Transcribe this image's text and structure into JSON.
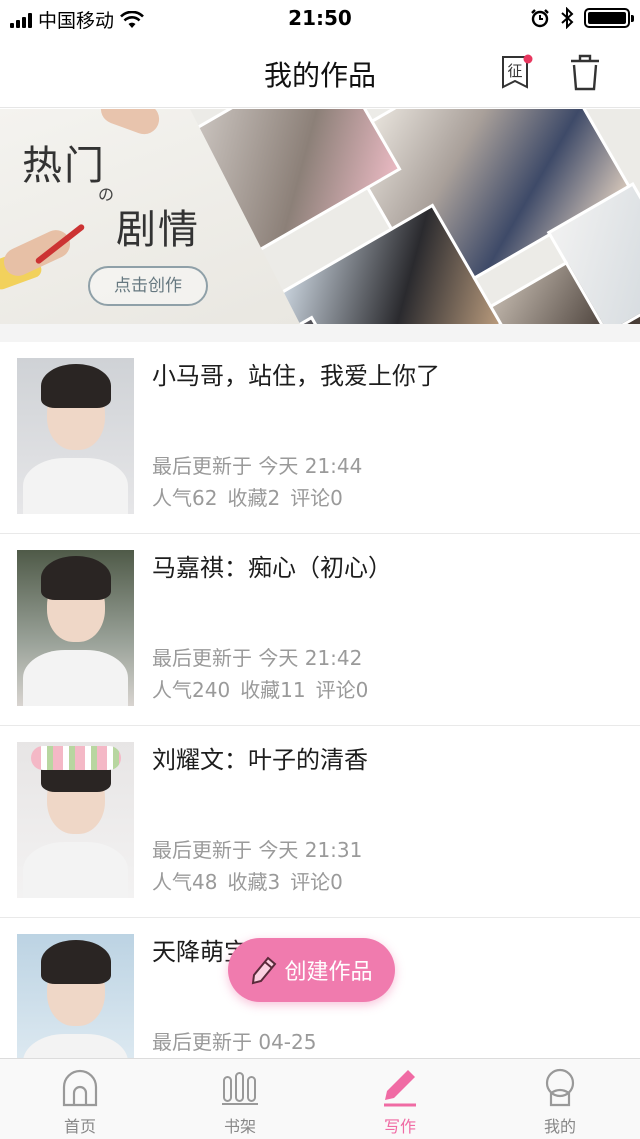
{
  "status_bar": {
    "carrier": "中国移动",
    "time": "21:50",
    "battery_level": 1.0
  },
  "header": {
    "title": "我的作品",
    "badge_icon_char": "征"
  },
  "banner": {
    "line1": "热门",
    "connector": "の",
    "line2": "剧情",
    "button_label": "点击创作"
  },
  "works": [
    {
      "title": "小马哥，站住，我爱上你了",
      "updated": "最后更新于 今天 21:44",
      "popularity": "人气62",
      "favorites": "收藏2",
      "comments": "评论0"
    },
    {
      "title": "马嘉祺：痴心（初心）",
      "updated": "最后更新于 今天 21:42",
      "popularity": "人气240",
      "favorites": "收藏11",
      "comments": "评论0"
    },
    {
      "title": "刘耀文：叶子的清香",
      "updated": "最后更新于 今天 21:31",
      "popularity": "人气48",
      "favorites": "收藏3",
      "comments": "评论0"
    },
    {
      "title": "天降萌宝：小马哥",
      "updated": "最后更新于 04-25",
      "popularity": "",
      "favorites": "",
      "comments": ""
    }
  ],
  "fab": {
    "label": "创建作品"
  },
  "tabs": [
    {
      "label": "首页",
      "icon": "home-icon",
      "active": false
    },
    {
      "label": "书架",
      "icon": "bookshelf-icon",
      "active": false
    },
    {
      "label": "写作",
      "icon": "pen-icon",
      "active": true
    },
    {
      "label": "我的",
      "icon": "profile-icon",
      "active": false
    }
  ],
  "colors": {
    "accent": "#f06ba4",
    "fab": "#f07bae",
    "muted_text": "#9a9a9a",
    "badge_dot": "#e8375f"
  }
}
